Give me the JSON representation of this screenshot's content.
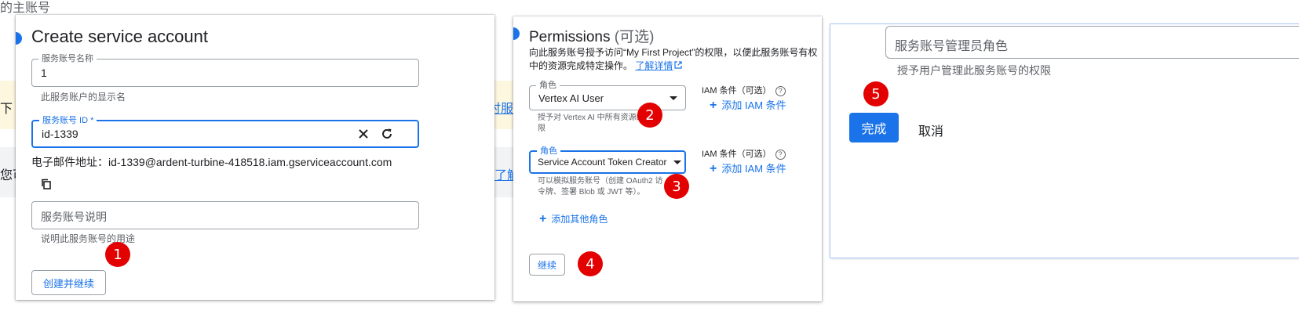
{
  "background": {
    "title_fragment": "的主账号",
    "fragment_left_1": "下",
    "fragment_link": "时服",
    "fragment_left_2": "您可",
    "fragment_link_2": "了解"
  },
  "panel1": {
    "title": "Create service account",
    "name_field": {
      "label": "服务账号名称",
      "value": "1",
      "helper": "此服务账户的显示名"
    },
    "id_field": {
      "label": "服务账号 ID *",
      "value": "id-1339"
    },
    "email_line": {
      "prefix": "电子邮件地址：",
      "value": "id-1339@ardent-turbine-418518.iam.gserviceaccount.com"
    },
    "desc_field": {
      "placeholder": "服务账号说明",
      "helper": "说明此服务账号的用途"
    },
    "create_button": "创建并继续",
    "badge": "1"
  },
  "panel2": {
    "title": "Permissions",
    "title_suffix": "(可选)",
    "description_1": "向此服务账号授予访问“My First Project”的权限，以便此服务账号有权",
    "description_2": "中的资源完成特定操作。",
    "learn_more": "了解详情",
    "role1": {
      "label": "角色",
      "value": "Vertex AI User",
      "helper_1": "授予对 Vertex AI 中所有资源的访",
      "helper_2": "限"
    },
    "role2": {
      "label": "角色",
      "value": "Service Account Token Creator",
      "helper_1": "可以模拟服务账号（创建 OAuth2 访",
      "helper_2": "令牌、签署 Blob 或 JWT 等）。"
    },
    "iam_condition_label": "IAM 条件（可选）",
    "add_iam_condition": "添加 IAM 条件",
    "add_other_role": "添加其他角色",
    "continue_button": "继续",
    "badge_2": "2",
    "badge_3": "3",
    "badge_4": "4"
  },
  "panel3": {
    "role_field_text": "服务账号管理员角色",
    "role_helper": "授予用户管理此服务账号的权限",
    "done_button": "完成",
    "cancel_button": "取消",
    "badge_5": "5"
  },
  "colors": {
    "accent": "#1a73e8",
    "badge": "#e30000"
  }
}
